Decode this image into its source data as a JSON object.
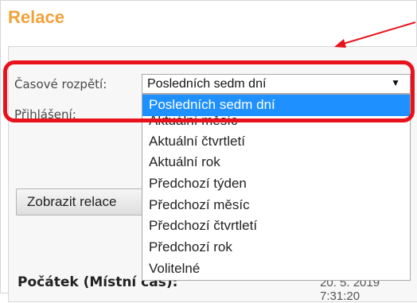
{
  "section": {
    "title": "Relace"
  },
  "form": {
    "time_range_label": "Časové rozpětí:",
    "login_label": "Přihlášení:",
    "time_range_select": {
      "selected": "Posledních sedm dní",
      "arrow_icon": "▼",
      "options": [
        "Posledních sedm dní",
        "Aktuální měsíc",
        "Aktuální čtvrtletí",
        "Aktuální rok",
        "Předchozí týden",
        "Předchozí měsíc",
        "Předchozí čtvrtletí",
        "Předchozí rok",
        "Volitelné"
      ]
    },
    "show_button_label": "Zobrazit relace"
  },
  "footer": {
    "start_label": "Počátek (Místní čas):",
    "start_value": "20. 5. 2019 7:31:20"
  },
  "annotation": {
    "color": "#e8121c"
  },
  "colors": {
    "title": "#f2a23a",
    "selection": "#1e90ff"
  }
}
